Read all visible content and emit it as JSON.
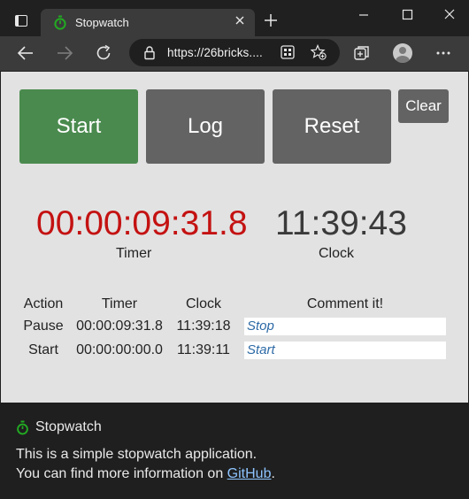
{
  "browser": {
    "tab_title": "Stopwatch",
    "url": "https://26bricks....",
    "accent_green": "#22aa22",
    "icons": {
      "window": "window-icon",
      "favicon": "stopwatch-icon",
      "tab_close": "close-icon",
      "new_tab": "plus-icon",
      "back": "back-arrow-icon",
      "forward": "forward-arrow-icon",
      "refresh": "refresh-icon",
      "lock": "lock-icon",
      "apps": "app-grid-icon",
      "favorite": "star-add-icon",
      "collections": "collections-icon",
      "profile": "profile-avatar-icon",
      "more": "more-dots-icon"
    }
  },
  "controls": {
    "start": "Start",
    "log": "Log",
    "reset": "Reset",
    "clear": "Clear",
    "start_color": "#4a8a4e",
    "button_color": "#636363"
  },
  "display": {
    "timer_value": "00:00:09:31.8",
    "timer_label": "Timer",
    "timer_color": "#c41212",
    "clock_value": "11:39:43",
    "clock_label": "Clock"
  },
  "log_table": {
    "headers": [
      "Action",
      "Timer",
      "Clock",
      "Comment it!"
    ],
    "rows": [
      {
        "action": "Pause",
        "timer": "00:00:09:31.8",
        "clock": "11:39:18",
        "comment": "Stop"
      },
      {
        "action": "Start",
        "timer": "00:00:00:00.0",
        "clock": "11:39:11",
        "comment": "Start"
      }
    ]
  },
  "footer": {
    "brand": "Stopwatch",
    "line1": "This is a simple stopwatch application.",
    "line2_prefix": "You can find more information on ",
    "link_text": "GitHub",
    "line2_suffix": "."
  }
}
